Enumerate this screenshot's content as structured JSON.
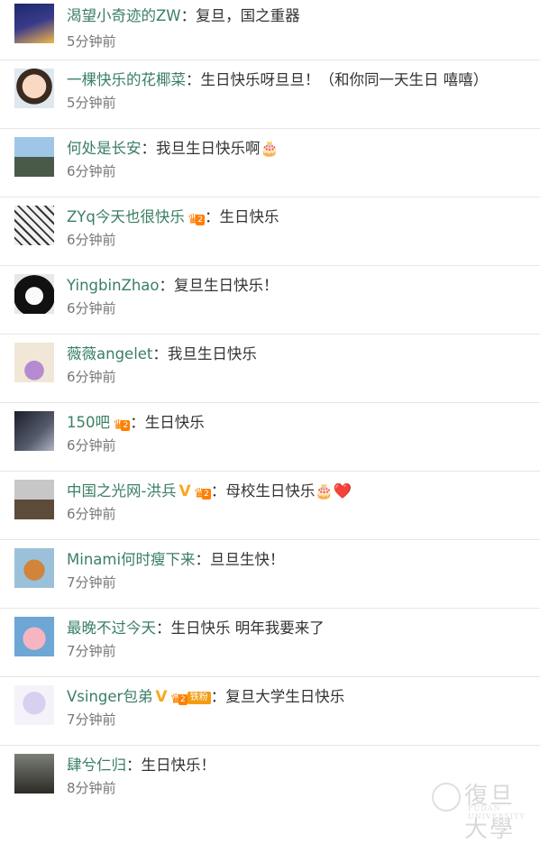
{
  "comments": [
    {
      "user": "渴望小奇迹的ZW",
      "text": "复旦，国之重器",
      "time": "5分钟前",
      "badges": []
    },
    {
      "user": "一棵快乐的花椰菜",
      "text": "生日快乐呀旦旦！（和你同一天生日 嘻嘻）",
      "time": "5分钟前",
      "badges": []
    },
    {
      "user": "何处是长安",
      "text": "我旦生日快乐啊🎂",
      "time": "6分钟前",
      "badges": []
    },
    {
      "user": "ZYq今天也很快乐",
      "text": "生日快乐",
      "time": "6分钟前",
      "badges": [
        "crown-lvl"
      ]
    },
    {
      "user": "YingbinZhao",
      "text": "复旦生日快乐！",
      "time": "6分钟前",
      "badges": []
    },
    {
      "user": "薇薇angelet",
      "text": "我旦生日快乐",
      "time": "6分钟前",
      "badges": []
    },
    {
      "user": "150吧",
      "text": "生日快乐",
      "time": "6分钟前",
      "badges": [
        "crown-lvl"
      ]
    },
    {
      "user": "中国之光网-洪兵",
      "text": "母校生日快乐🎂❤️",
      "time": "6分钟前",
      "badges": [
        "vip",
        "crown-lvl"
      ]
    },
    {
      "user": "Minami何时瘦下来",
      "text": "旦旦生快！",
      "time": "7分钟前",
      "badges": []
    },
    {
      "user": "最晚不过今天",
      "text": "生日快乐  明年我要来了",
      "time": "7分钟前",
      "badges": []
    },
    {
      "user": "Vsinger包弟",
      "text": "复旦大学生日快乐",
      "time": "7分钟前",
      "badges": [
        "vip",
        "crown-lvl",
        "fan"
      ]
    },
    {
      "user": "肆兮仁归",
      "text": "生日快乐！",
      "time": "8分钟前",
      "badges": []
    }
  ],
  "badge_labels": {
    "fan": "铁粉",
    "lvl": "2"
  },
  "separator": "：",
  "watermark": {
    "text": "復旦大學",
    "subtitle": "FUDAN UNIVERSITY"
  },
  "colors": {
    "username": "#3a7f63",
    "text": "#333333",
    "time": "#777777",
    "vip": "#f7a823",
    "badge": "#ff7f00"
  }
}
